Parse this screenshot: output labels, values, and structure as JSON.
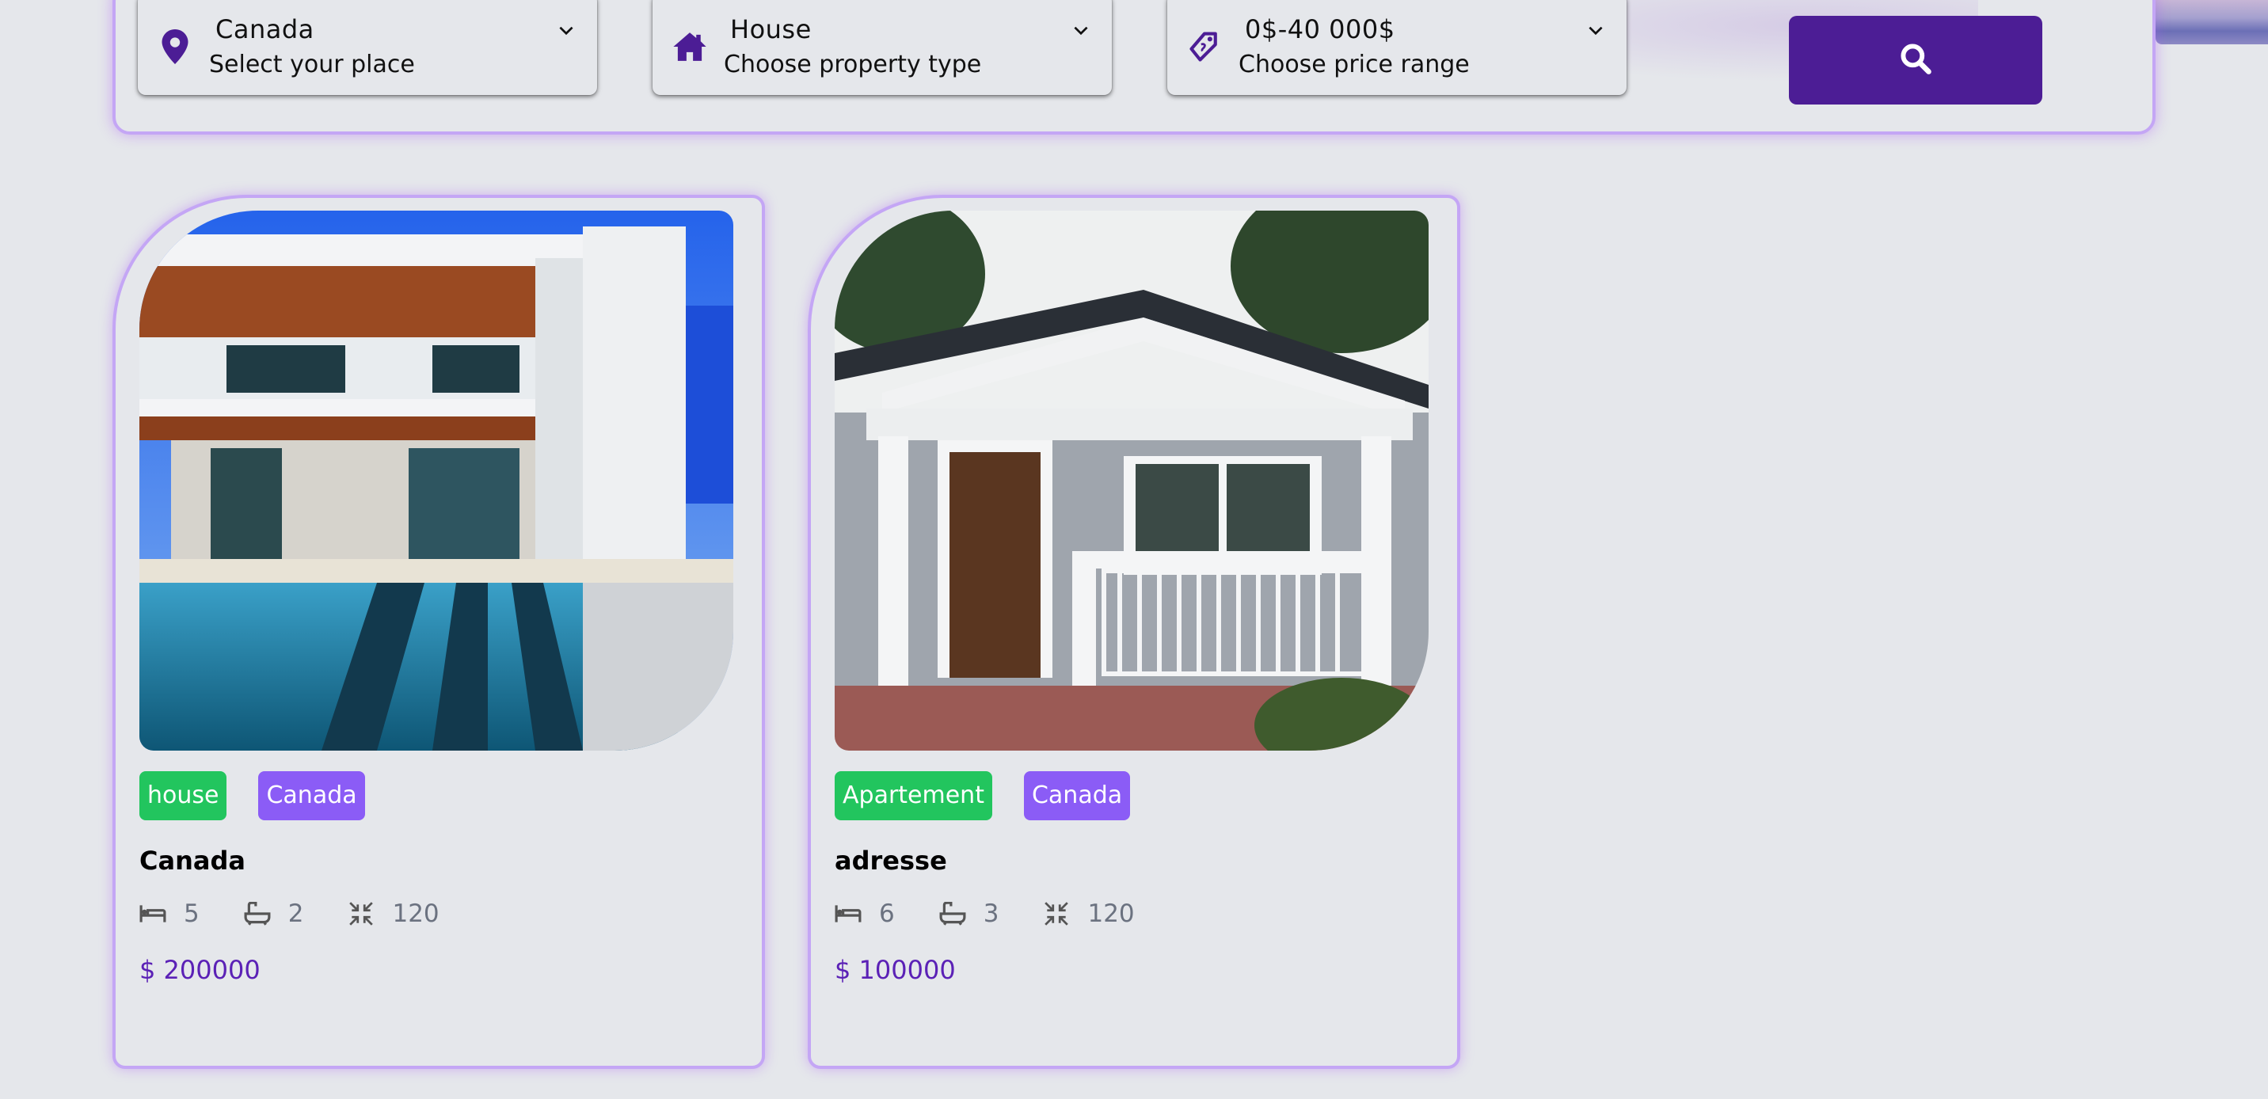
{
  "filters": {
    "place": {
      "value": "Canada",
      "hint": "Select your place",
      "icon": "map-pin-icon"
    },
    "property_type": {
      "value": "House",
      "hint": "Choose property type",
      "icon": "house-icon"
    },
    "price_range": {
      "value": "0$-40 000$",
      "hint": "Choose price range",
      "icon": "price-tag-icon"
    },
    "search_icon": "search-icon"
  },
  "listings": [
    {
      "type_tag": "house",
      "location_tag": "Canada",
      "title": "Canada",
      "beds": "5",
      "baths": "2",
      "area": "120",
      "price": "$ 200000"
    },
    {
      "type_tag": "Apartement",
      "location_tag": "Canada",
      "title": "adresse",
      "beds": "6",
      "baths": "3",
      "area": "120",
      "price": "$ 100000"
    }
  ],
  "colors": {
    "accent": "#4c1d95",
    "tag_type": "#22c55e",
    "tag_location": "#8b5cf6",
    "price": "#5b21b6",
    "border_glow": "#c4a6f5"
  }
}
